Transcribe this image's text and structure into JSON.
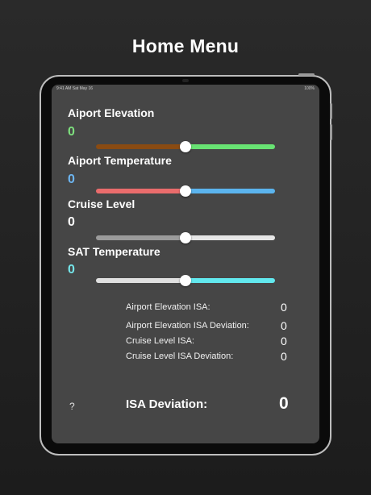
{
  "headline": "Home Menu",
  "status_bar": {
    "time": "9:41 AM  Sat May 16",
    "right": "100%"
  },
  "fields": [
    {
      "label": "Aiport Elevation",
      "value": "0",
      "value_color": "#7ee07e",
      "slider": {
        "level": 0.5,
        "left_color": "#8a4b12",
        "right_color": "#68e373"
      }
    },
    {
      "label": "Aiport Temperature",
      "value": "0",
      "value_color": "#6db6f2",
      "slider": {
        "level": 0.5,
        "left_color": "#ea6c6c",
        "right_color": "#5bb4ee"
      }
    },
    {
      "label": "Cruise Level",
      "value": "0",
      "value_color": "#ffffff",
      "slider": {
        "level": 0.5,
        "left_color": "#9b9b9b",
        "right_color": "#e6e6e6"
      }
    },
    {
      "label": "SAT Temperature",
      "value": "0",
      "value_color": "#75e6ea",
      "slider": {
        "level": 0.5,
        "left_color": "#e0e0e0",
        "right_color": "#62e8ee"
      }
    }
  ],
  "results": [
    {
      "label": "Airport Elevation ISA:",
      "value": "0"
    },
    {
      "label": "Airport Elevation ISA Deviation:",
      "value": "0"
    },
    {
      "label": "Cruise Level ISA:",
      "value": "0"
    },
    {
      "label": "Cruise Level ISA Deviation:",
      "value": "0"
    }
  ],
  "help_label": "?",
  "isa_deviation": {
    "label": "ISA Deviation:",
    "value": "0"
  }
}
